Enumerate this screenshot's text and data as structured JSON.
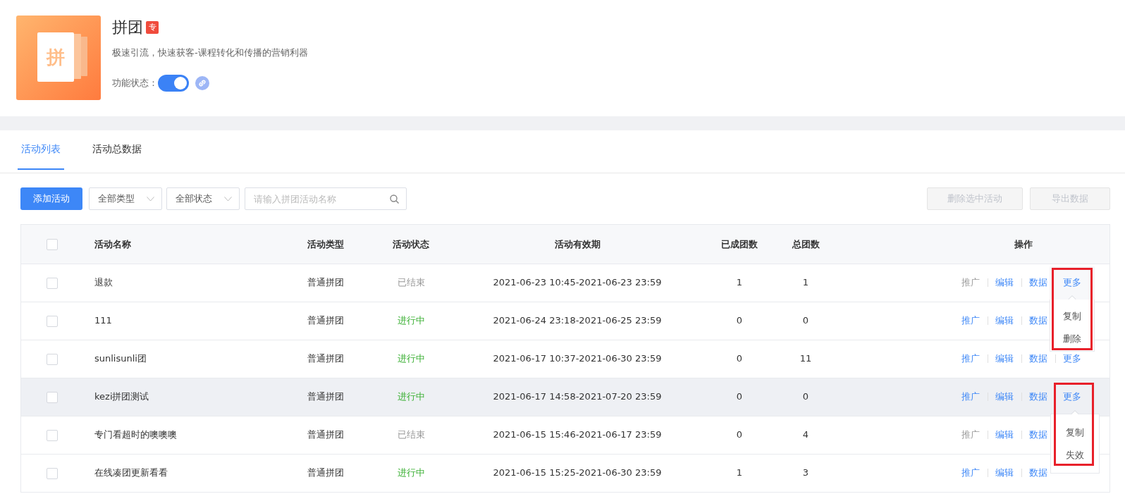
{
  "app": {
    "icon_text": "拼",
    "title": "拼团",
    "badge": "专",
    "description": "极速引流，快速获客-课程转化和传播的营销利器",
    "status_label": "功能状态：",
    "status_on": true
  },
  "tabs": [
    {
      "label": "活动列表",
      "selected": true
    },
    {
      "label": "活动总数据",
      "selected": false
    }
  ],
  "toolbar": {
    "add_button": "添加活动",
    "filters": [
      {
        "label": "全部类型"
      },
      {
        "label": "全部状态"
      }
    ],
    "search": {
      "placeholder": "请输入拼团活动名称"
    },
    "actions": [
      {
        "label": "删除选中活动",
        "disabled": true
      },
      {
        "label": "导出数据",
        "disabled": true
      }
    ]
  },
  "table": {
    "select_all": {
      "checked": false
    },
    "columns": [
      "活动名称",
      "活动类型",
      "活动状态",
      "活动有效期",
      "已成团数",
      "总团数",
      "操作"
    ],
    "rows": [
      {
        "checked": false,
        "hovered": false,
        "name": "退款",
        "type": "普通拼团",
        "status": {
          "label": "已结束",
          "kind": "ended"
        },
        "period": "2021-06-23 10:45-2021-06-23 23:59",
        "formed": "1",
        "total": "1",
        "actions": [
          {
            "label": "推广",
            "disabled": true
          },
          {
            "label": "编辑",
            "disabled": false
          },
          {
            "label": "数据",
            "disabled": false
          },
          {
            "label": "更多",
            "disabled": false
          }
        ],
        "menu": {
          "kind": "dropdown",
          "items": [
            "复制",
            "删除"
          ]
        },
        "annotated": true
      },
      {
        "checked": false,
        "hovered": false,
        "name": "111",
        "type": "普通拼团",
        "status": {
          "label": "进行中",
          "kind": "active"
        },
        "period": "2021-06-24 23:18-2021-06-25 23:59",
        "formed": "0",
        "total": "0",
        "actions": [
          {
            "label": "推广",
            "disabled": false
          },
          {
            "label": "编辑",
            "disabled": false
          },
          {
            "label": "数据",
            "disabled": false
          }
        ],
        "annotated": false
      },
      {
        "checked": false,
        "hovered": false,
        "name": "sunlisunli团",
        "type": "普通拼团",
        "status": {
          "label": "进行中",
          "kind": "active"
        },
        "period": "2021-06-17 10:37-2021-06-30 23:59",
        "formed": "0",
        "total": "11",
        "actions": [
          {
            "label": "推广",
            "disabled": false
          },
          {
            "label": "编辑",
            "disabled": false
          },
          {
            "label": "数据",
            "disabled": false
          },
          {
            "label": "更多",
            "disabled": false
          }
        ],
        "annotated": false
      },
      {
        "checked": false,
        "hovered": true,
        "name": "kezi拼团测试",
        "type": "普通拼团",
        "status": {
          "label": "进行中",
          "kind": "active"
        },
        "period": "2021-06-17 14:58-2021-07-20 23:59",
        "formed": "0",
        "total": "0",
        "actions": [
          {
            "label": "推广",
            "disabled": false
          },
          {
            "label": "编辑",
            "disabled": false
          },
          {
            "label": "数据",
            "disabled": false
          },
          {
            "label": "更多",
            "disabled": false
          }
        ],
        "menu": {
          "kind": "popover",
          "items": [
            "复制",
            "失效"
          ]
        },
        "annotated": true
      },
      {
        "checked": false,
        "hovered": false,
        "name": "专门看超时的噢噢噢",
        "type": "普通拼团",
        "status": {
          "label": "已结束",
          "kind": "ended"
        },
        "period": "2021-06-15 15:46-2021-06-17 23:59",
        "formed": "0",
        "total": "4",
        "actions": [
          {
            "label": "推广",
            "disabled": true
          },
          {
            "label": "编辑",
            "disabled": false
          },
          {
            "label": "数据",
            "disabled": false
          }
        ],
        "annotated": false
      },
      {
        "checked": false,
        "hovered": false,
        "name": "在线凑团更新看看",
        "type": "普通拼团",
        "status": {
          "label": "进行中",
          "kind": "active"
        },
        "period": "2021-06-15 15:25-2021-06-30 23:59",
        "formed": "1",
        "total": "3",
        "actions": [
          {
            "label": "推广",
            "disabled": false
          },
          {
            "label": "编辑",
            "disabled": false
          },
          {
            "label": "数据",
            "disabled": false
          }
        ],
        "annotated": false
      }
    ]
  }
}
